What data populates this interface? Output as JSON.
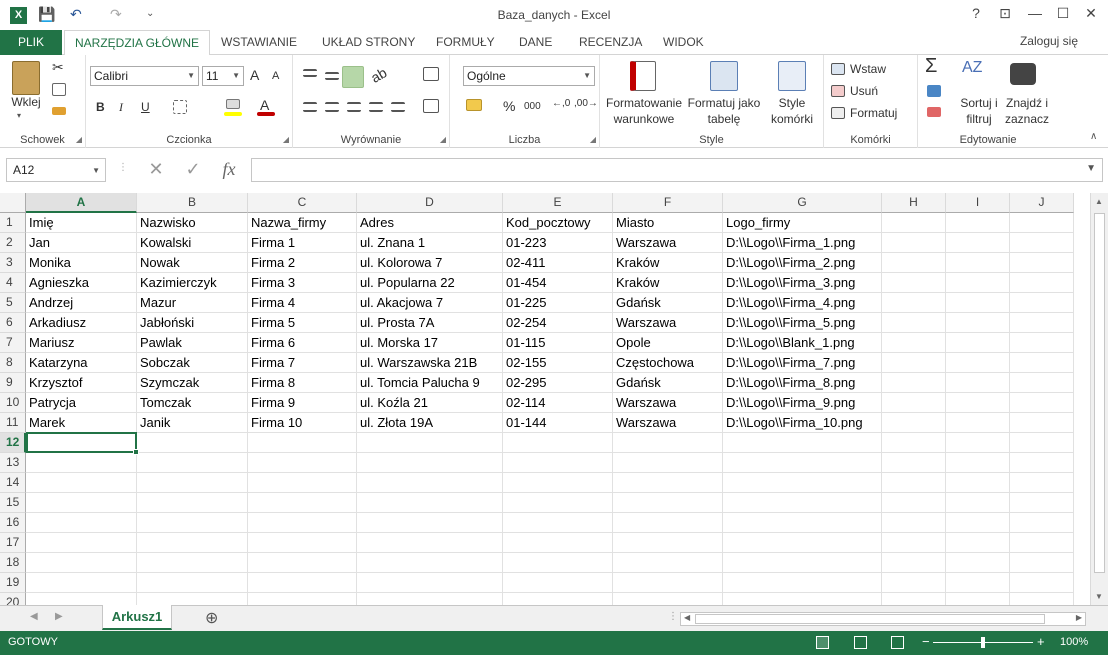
{
  "window": {
    "title": "Baza_danych - Excel",
    "help": "?",
    "restore_ribbon": "⊡",
    "minimize": "—",
    "maximize": "☐",
    "close": "✕"
  },
  "quick_access": {
    "save": "💾",
    "undo": "↶",
    "redo": "↷",
    "customize": "⌄"
  },
  "tabs": [
    {
      "label": "PLIK"
    },
    {
      "label": "NARZĘDZIA GŁÓWNE"
    },
    {
      "label": "WSTAWIANIE"
    },
    {
      "label": "UKŁAD STRONY"
    },
    {
      "label": "FORMUŁY"
    },
    {
      "label": "DANE"
    },
    {
      "label": "RECENZJA"
    },
    {
      "label": "WIDOK"
    }
  ],
  "login": "Zaloguj się",
  "ribbon": {
    "clipboard": {
      "label": "Schowek",
      "paste": "Wklej"
    },
    "font": {
      "label": "Czcionka",
      "font_name": "Calibri",
      "font_size": "11",
      "grow": "A",
      "shrink": "A",
      "bold": "B",
      "italic": "I",
      "underline": "U"
    },
    "alignment": {
      "label": "Wyrównanie"
    },
    "number": {
      "label": "Liczba",
      "format": "Ogólne",
      "percent": "%",
      "thousands": "000"
    },
    "styles": {
      "label": "Style",
      "conditional": "Formatowanie warunkowe",
      "table": "Formatuj jako tabelę",
      "cell_styles": "Style komórki"
    },
    "cells": {
      "label": "Komórki",
      "insert": "Wstaw",
      "delete": "Usuń",
      "format": "Formatuj"
    },
    "editing": {
      "label": "Edytowanie",
      "sort": "Sortuj i filtruj",
      "find": "Znajdź i zaznacz",
      "sum": "Σ"
    }
  },
  "formula_bar": {
    "name_box": "A12",
    "cancel": "✕",
    "enter": "✓",
    "fx": "fx",
    "value": ""
  },
  "columns": [
    "A",
    "B",
    "C",
    "D",
    "E",
    "F",
    "G",
    "H",
    "I",
    "J"
  ],
  "rows": [
    [
      "Imię",
      "Nazwisko",
      "Nazwa_firmy",
      "Adres",
      "Kod_pocztowy",
      "Miasto",
      "Logo_firmy"
    ],
    [
      "Jan",
      "Kowalski",
      "Firma 1",
      "ul. Znana 1",
      "01-223",
      "Warszawa",
      "D:\\\\Logo\\\\Firma_1.png"
    ],
    [
      "Monika",
      "Nowak",
      "Firma 2",
      "ul. Kolorowa 7",
      "02-411",
      "Kraków",
      "D:\\\\Logo\\\\Firma_2.png"
    ],
    [
      "Agnieszka",
      "Kazimierczyk",
      "Firma 3",
      "ul. Popularna 22",
      "01-454",
      "Kraków",
      "D:\\\\Logo\\\\Firma_3.png"
    ],
    [
      "Andrzej",
      "Mazur",
      "Firma 4",
      "ul. Akacjowa 7",
      "01-225",
      "Gdańsk",
      "D:\\\\Logo\\\\Firma_4.png"
    ],
    [
      "Arkadiusz",
      "Jabłoński",
      "Firma 5",
      "ul. Prosta 7A",
      "02-254",
      "Warszawa",
      "D:\\\\Logo\\\\Firma_5.png"
    ],
    [
      "Mariusz",
      "Pawlak",
      "Firma 6",
      "ul. Morska 17",
      "01-115",
      "Opole",
      "D:\\\\Logo\\\\Blank_1.png"
    ],
    [
      "Katarzyna",
      "Sobczak",
      "Firma 7",
      "ul. Warszawska 21B",
      "02-155",
      "Częstochowa",
      "D:\\\\Logo\\\\Firma_7.png"
    ],
    [
      "Krzysztof",
      "Szymczak",
      "Firma 8",
      "ul. Tomcia Palucha 9",
      "02-295",
      "Gdańsk",
      "D:\\\\Logo\\\\Firma_8.png"
    ],
    [
      "Patrycja",
      "Tomczak",
      "Firma 9",
      "ul. Koźla 21",
      "02-114",
      "Warszawa",
      "D:\\\\Logo\\\\Firma_9.png"
    ],
    [
      "Marek",
      "Janik",
      "Firma 10",
      "ul. Złota 19A",
      "01-144",
      "Warszawa",
      "D:\\\\Logo\\\\Firma_10.png"
    ]
  ],
  "row_numbers": [
    "1",
    "2",
    "3",
    "4",
    "5",
    "6",
    "7",
    "8",
    "9",
    "10",
    "11",
    "12",
    "13",
    "14",
    "15",
    "16",
    "17",
    "18",
    "19",
    "20"
  ],
  "sheet": {
    "name": "Arkusz1",
    "add": "⊕"
  },
  "status": {
    "text": "GOTOWY",
    "zoom": "100%",
    "zoom_minus": "−",
    "zoom_plus": "+"
  },
  "colors": {
    "accent": "#217346"
  }
}
